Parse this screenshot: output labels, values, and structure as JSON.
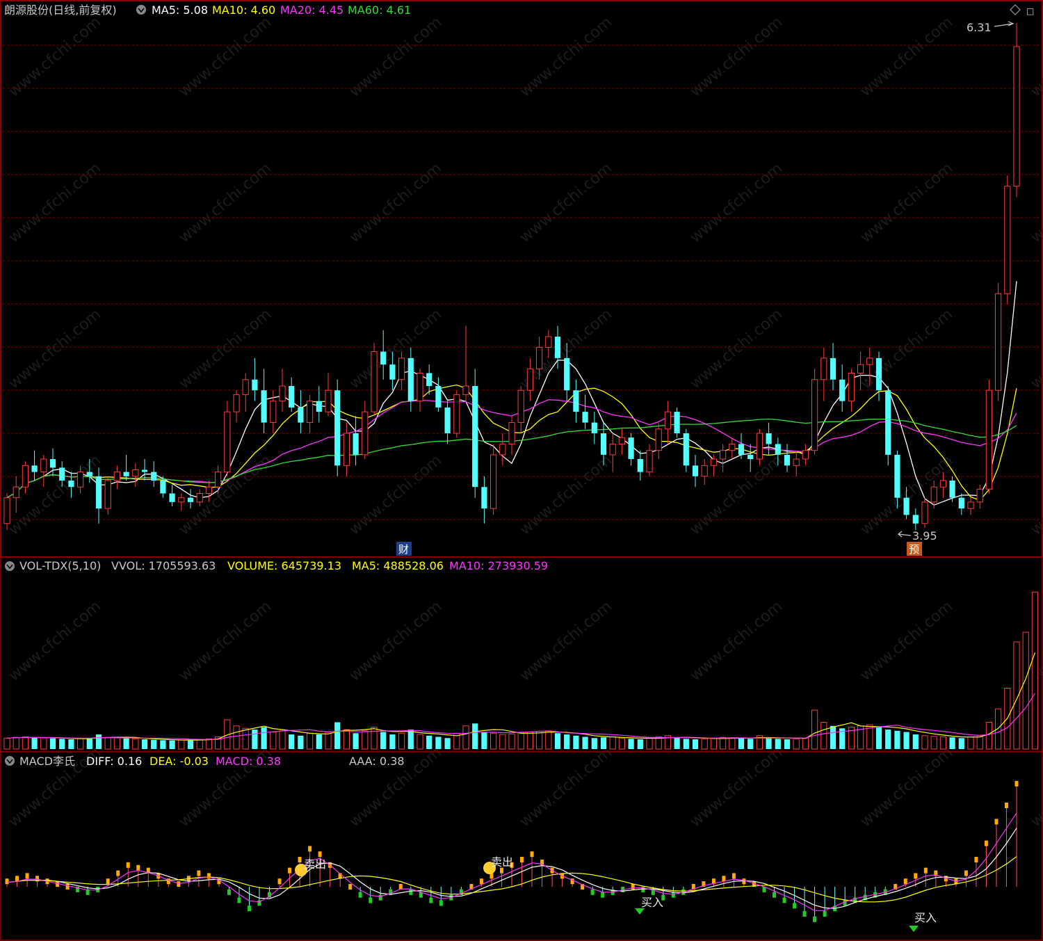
{
  "colors": {
    "up": "#ff3b3b",
    "down": "#54ffff",
    "ma5": "#ffffff",
    "ma10": "#ffff00",
    "ma20": "#ff33ff",
    "ma60": "#33dd33",
    "grid": "#7a0000",
    "frame": "#9b0000",
    "label": "#c8c8c8",
    "macd_pos": "#ffaa00",
    "macd_neg": "#22cc22"
  },
  "main_panel": {
    "stock": "朗源股份(日线,前复权)",
    "ma5": "MA5: 5.08",
    "ma10": "MA10: 4.60",
    "ma20": "MA20: 4.45",
    "ma60": "MA60: 4.61",
    "high_label": "6.31",
    "low_label": "3.95",
    "tag_cai": "财",
    "tag_yu": "预",
    "corner_icon": "diamond-icon"
  },
  "vol_panel": {
    "name": "VOL-TDX(5,10)",
    "vvol": "VVOL: 1705593.63",
    "volume": "VOLUME: 645739.13",
    "ma5": "MA5: 488528.06",
    "ma10": "MA10: 273930.59"
  },
  "macd_panel": {
    "name": "MACD李氏",
    "diff": "DIFF: 0.16",
    "dea": "DEA: -0.03",
    "macd": "MACD: 0.38",
    "aaa": "AAA: 0.38",
    "sell": "卖出",
    "buy": "买入"
  },
  "watermark": "www.cfchi.com",
  "chart_data": {
    "type": "candlestick",
    "title": "朗源股份(日线,前复权)",
    "period": "daily",
    "price_range_visible": [
      3.95,
      6.31
    ],
    "candles": [
      [
        3.98,
        4.12,
        3.95,
        4.1
      ],
      [
        4.1,
        4.2,
        4.03,
        4.15
      ],
      [
        4.15,
        4.27,
        4.12,
        4.25
      ],
      [
        4.25,
        4.32,
        4.18,
        4.22
      ],
      [
        4.22,
        4.3,
        4.15,
        4.28
      ],
      [
        4.28,
        4.33,
        4.2,
        4.24
      ],
      [
        4.24,
        4.27,
        4.15,
        4.18
      ],
      [
        4.18,
        4.22,
        4.1,
        4.15
      ],
      [
        4.15,
        4.25,
        4.12,
        4.22
      ],
      [
        4.22,
        4.28,
        4.17,
        4.2
      ],
      [
        4.2,
        4.24,
        3.98,
        4.05
      ],
      [
        4.05,
        4.2,
        4.02,
        4.18
      ],
      [
        4.18,
        4.25,
        4.14,
        4.22
      ],
      [
        4.22,
        4.3,
        4.18,
        4.2
      ],
      [
        4.2,
        4.26,
        4.15,
        4.23
      ],
      [
        4.23,
        4.28,
        4.18,
        4.22
      ],
      [
        4.22,
        4.27,
        4.15,
        4.18
      ],
      [
        4.18,
        4.2,
        4.1,
        4.12
      ],
      [
        4.12,
        4.16,
        4.06,
        4.08
      ],
      [
        4.08,
        4.12,
        4.04,
        4.1
      ],
      [
        4.1,
        4.14,
        4.05,
        4.08
      ],
      [
        4.08,
        4.14,
        4.06,
        4.12
      ],
      [
        4.12,
        4.18,
        4.08,
        4.15
      ],
      [
        4.15,
        4.25,
        4.12,
        4.22
      ],
      [
        4.22,
        4.55,
        4.2,
        4.5
      ],
      [
        4.5,
        4.6,
        4.45,
        4.58
      ],
      [
        4.58,
        4.68,
        4.5,
        4.65
      ],
      [
        4.65,
        4.75,
        4.55,
        4.6
      ],
      [
        4.6,
        4.7,
        4.4,
        4.45
      ],
      [
        4.45,
        4.6,
        4.4,
        4.55
      ],
      [
        4.55,
        4.7,
        4.5,
        4.62
      ],
      [
        4.62,
        4.66,
        4.5,
        4.52
      ],
      [
        4.52,
        4.6,
        4.4,
        4.45
      ],
      [
        4.45,
        4.58,
        4.4,
        4.55
      ],
      [
        4.55,
        4.62,
        4.45,
        4.5
      ],
      [
        4.5,
        4.68,
        4.48,
        4.6
      ],
      [
        4.6,
        4.65,
        4.2,
        4.25
      ],
      [
        4.25,
        4.45,
        4.2,
        4.4
      ],
      [
        4.4,
        4.48,
        4.25,
        4.3
      ],
      [
        4.3,
        4.55,
        4.28,
        4.5
      ],
      [
        4.5,
        4.82,
        4.48,
        4.78
      ],
      [
        4.78,
        4.88,
        4.65,
        4.72
      ],
      [
        4.72,
        4.78,
        4.6,
        4.65
      ],
      [
        4.65,
        4.78,
        4.6,
        4.75
      ],
      [
        4.75,
        4.8,
        4.5,
        4.55
      ],
      [
        4.55,
        4.7,
        4.5,
        4.68
      ],
      [
        4.68,
        4.72,
        4.58,
        4.62
      ],
      [
        4.62,
        4.66,
        4.5,
        4.52
      ],
      [
        4.52,
        4.55,
        4.35,
        4.4
      ],
      [
        4.4,
        4.6,
        4.38,
        4.58
      ],
      [
        4.58,
        4.9,
        4.55,
        4.62
      ],
      [
        4.62,
        4.7,
        4.1,
        4.15
      ],
      [
        4.15,
        4.2,
        3.98,
        4.05
      ],
      [
        4.05,
        4.35,
        4.02,
        4.3
      ],
      [
        4.3,
        4.4,
        4.25,
        4.35
      ],
      [
        4.35,
        4.48,
        4.3,
        4.45
      ],
      [
        4.45,
        4.62,
        4.4,
        4.6
      ],
      [
        4.6,
        4.75,
        4.55,
        4.7
      ],
      [
        4.7,
        4.85,
        4.65,
        4.8
      ],
      [
        4.8,
        4.88,
        4.75,
        4.85
      ],
      [
        4.85,
        4.9,
        4.7,
        4.75
      ],
      [
        4.75,
        4.82,
        4.55,
        4.6
      ],
      [
        4.6,
        4.65,
        4.45,
        4.5
      ],
      [
        4.5,
        4.58,
        4.42,
        4.45
      ],
      [
        4.45,
        4.5,
        4.35,
        4.4
      ],
      [
        4.4,
        4.45,
        4.25,
        4.3
      ],
      [
        4.3,
        4.4,
        4.22,
        4.35
      ],
      [
        4.35,
        4.42,
        4.3,
        4.38
      ],
      [
        4.38,
        4.4,
        4.25,
        4.28
      ],
      [
        4.28,
        4.32,
        4.18,
        4.22
      ],
      [
        4.22,
        4.35,
        4.2,
        4.32
      ],
      [
        4.32,
        4.45,
        4.28,
        4.42
      ],
      [
        4.42,
        4.55,
        4.35,
        4.5
      ],
      [
        4.5,
        4.52,
        4.38,
        4.4
      ],
      [
        4.4,
        4.42,
        4.22,
        4.25
      ],
      [
        4.25,
        4.3,
        4.15,
        4.2
      ],
      [
        4.2,
        4.28,
        4.16,
        4.25
      ],
      [
        4.25,
        4.3,
        4.2,
        4.28
      ],
      [
        4.28,
        4.35,
        4.22,
        4.32
      ],
      [
        4.32,
        4.38,
        4.28,
        4.35
      ],
      [
        4.35,
        4.4,
        4.28,
        4.3
      ],
      [
        4.3,
        4.35,
        4.22,
        4.28
      ],
      [
        4.28,
        4.42,
        4.25,
        4.4
      ],
      [
        4.4,
        4.45,
        4.3,
        4.35
      ],
      [
        4.35,
        4.38,
        4.25,
        4.3
      ],
      [
        4.3,
        4.35,
        4.22,
        4.25
      ],
      [
        4.25,
        4.32,
        4.2,
        4.28
      ],
      [
        4.28,
        4.35,
        4.25,
        4.32
      ],
      [
        4.32,
        4.7,
        4.3,
        4.65
      ],
      [
        4.65,
        4.8,
        4.55,
        4.75
      ],
      [
        4.75,
        4.82,
        4.6,
        4.65
      ],
      [
        4.65,
        4.72,
        4.5,
        4.55
      ],
      [
        4.55,
        4.7,
        4.5,
        4.68
      ],
      [
        4.68,
        4.78,
        4.6,
        4.72
      ],
      [
        4.72,
        4.8,
        4.62,
        4.75
      ],
      [
        4.75,
        4.78,
        4.55,
        4.6
      ],
      [
        4.6,
        4.62,
        4.25,
        4.3
      ],
      [
        4.3,
        4.32,
        4.05,
        4.1
      ],
      [
        4.1,
        4.15,
        4.0,
        4.02
      ],
      [
        4.02,
        4.05,
        3.95,
        3.98
      ],
      [
        3.98,
        4.1,
        3.96,
        4.08
      ],
      [
        4.08,
        4.18,
        4.05,
        4.15
      ],
      [
        4.15,
        4.22,
        4.1,
        4.18
      ],
      [
        4.18,
        4.2,
        4.08,
        4.1
      ],
      [
        4.1,
        4.12,
        4.02,
        4.05
      ],
      [
        4.05,
        4.1,
        4.02,
        4.08
      ],
      [
        4.08,
        4.16,
        4.05,
        4.14
      ],
      [
        4.14,
        4.65,
        4.12,
        4.6
      ],
      [
        4.6,
        5.1,
        4.55,
        5.05
      ],
      [
        5.05,
        5.6,
        5.0,
        5.55
      ],
      [
        5.55,
        6.31,
        5.5,
        6.2
      ]
    ],
    "ma5": [
      4.1,
      4.15,
      4.18,
      4.2,
      4.22,
      4.22,
      4.2,
      4.17,
      4.15,
      4.15
    ],
    "ma10": [
      4.12,
      4.14,
      4.16,
      4.18,
      4.19,
      4.2,
      4.2,
      4.19,
      4.18,
      4.17
    ],
    "ma20": [
      4.1,
      4.12,
      4.14,
      4.16,
      4.18,
      4.2,
      4.22,
      4.25,
      4.3,
      4.38
    ],
    "ma60": [
      4.2,
      4.22,
      4.24,
      4.26,
      4.3,
      4.35,
      4.4,
      4.42,
      4.45,
      4.48
    ],
    "volume": [
      45,
      48,
      50,
      47,
      46,
      44,
      42,
      40,
      43,
      45,
      60,
      48,
      46,
      44,
      42,
      40,
      38,
      36,
      35,
      37,
      38,
      40,
      42,
      50,
      120,
      95,
      85,
      80,
      90,
      70,
      75,
      60,
      55,
      65,
      60,
      70,
      110,
      80,
      65,
      75,
      90,
      70,
      60,
      65,
      80,
      60,
      55,
      50,
      45,
      65,
      95,
      105,
      70,
      65,
      60,
      62,
      68,
      70,
      72,
      75,
      65,
      60,
      55,
      50,
      45,
      48,
      50,
      45,
      42,
      40,
      45,
      50,
      55,
      48,
      42,
      40,
      42,
      45,
      48,
      46,
      44,
      42,
      55,
      48,
      42,
      40,
      42,
      45,
      160,
      110,
      95,
      85,
      90,
      95,
      100,
      90,
      80,
      75,
      70,
      60,
      55,
      52,
      50,
      48,
      45,
      50,
      55,
      110,
      165,
      250,
      440,
      480,
      645
    ],
    "macd": [
      0.02,
      0.03,
      0.04,
      0.03,
      0.02,
      0.01,
      0.0,
      -0.01,
      -0.02,
      -0.01,
      0.02,
      0.05,
      0.08,
      0.07,
      0.06,
      0.04,
      0.02,
      0.01,
      0.03,
      0.05,
      0.04,
      0.02,
      -0.02,
      -0.05,
      -0.08,
      -0.06,
      -0.03,
      0.02,
      0.06,
      0.1,
      0.14,
      0.12,
      0.08,
      0.04,
      0.0,
      -0.03,
      -0.05,
      -0.04,
      -0.02,
      0.0,
      -0.02,
      -0.03,
      -0.05,
      -0.06,
      -0.04,
      -0.02,
      0.0,
      0.02,
      0.04,
      0.06,
      0.08,
      0.1,
      0.12,
      0.09,
      0.06,
      0.04,
      0.02,
      0.0,
      -0.02,
      -0.03,
      -0.02,
      -0.01,
      0.0,
      -0.01,
      -0.02,
      -0.04,
      -0.03,
      -0.02,
      0.0,
      0.01,
      0.02,
      0.03,
      0.04,
      0.02,
      0.01,
      -0.01,
      -0.03,
      -0.05,
      -0.07,
      -0.1,
      -0.12,
      -0.1,
      -0.08,
      -0.06,
      -0.05,
      -0.04,
      -0.03,
      -0.02,
      0.0,
      0.02,
      0.04,
      0.06,
      0.05,
      0.03,
      0.02,
      0.05,
      0.1,
      0.16,
      0.24,
      0.3,
      0.38
    ]
  }
}
